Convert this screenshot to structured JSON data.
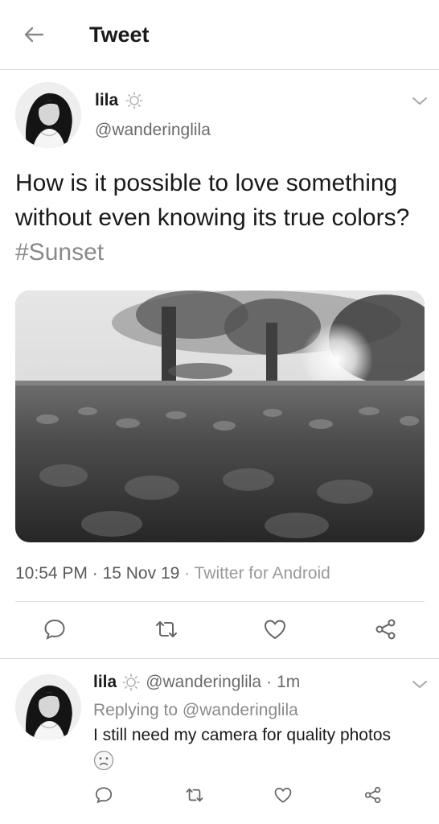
{
  "header": {
    "title": "Tweet"
  },
  "tweet": {
    "name": "lila",
    "handle": "@wanderinglila",
    "text_main": "How is it possible to love something without even knowing its true colors?",
    "hashtag": "#Sunset",
    "time": "10:54 PM",
    "date": "15 Nov 19",
    "source": "Twitter for Android",
    "sep": "·"
  },
  "reply": {
    "name": "lila",
    "handle": "@wanderinglila",
    "age": "1m",
    "sep": "·",
    "replying_prefix": "Replying to",
    "replying_handle": "@wanderinglila",
    "text": "I still need my camera for quality photos"
  },
  "icons": {
    "back": "arrow-left-icon",
    "verified": "sun-badge-icon",
    "caret": "chevron-down-icon",
    "reply": "comment-icon",
    "retweet": "retweet-icon",
    "like": "heart-icon",
    "share": "share-icon",
    "emoji": "frowning-face-icon"
  },
  "colors": {
    "text": "#1a1a1a",
    "secondary": "#6b6b6b",
    "muted": "#9a9a9a",
    "divider": "#e2e2e2"
  }
}
